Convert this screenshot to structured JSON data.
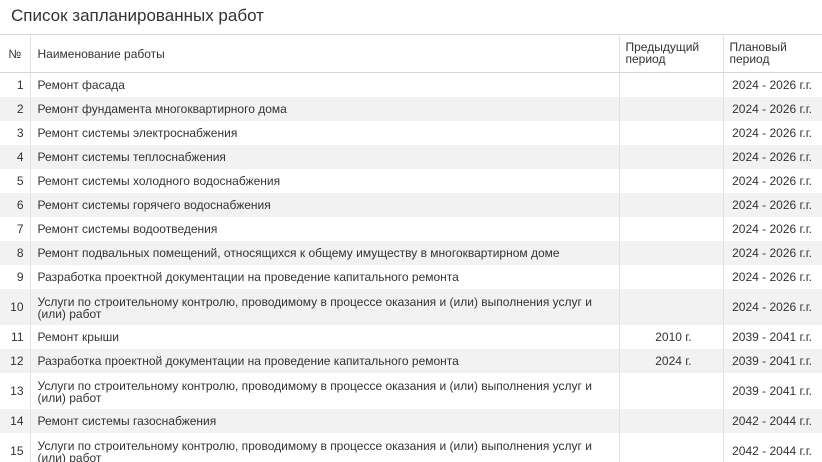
{
  "page": {
    "title": "Список запланированных работ"
  },
  "table": {
    "headers": {
      "num": "№",
      "name": "Наименование работы",
      "prev_line1": "Предыдущий",
      "prev_line2": "период",
      "plan_line1": "Плановый",
      "plan_line2": "период"
    },
    "rows": [
      {
        "num": "1",
        "name": "Ремонт фасада",
        "prev": "",
        "plan": "2024 - 2026 г.г."
      },
      {
        "num": "2",
        "name": "Ремонт фундамента многоквартирного дома",
        "prev": "",
        "plan": "2024 - 2026 г.г."
      },
      {
        "num": "3",
        "name": "Ремонт системы электроснабжения",
        "prev": "",
        "plan": "2024 - 2026 г.г."
      },
      {
        "num": "4",
        "name": "Ремонт системы теплоснабжения",
        "prev": "",
        "plan": "2024 - 2026 г.г."
      },
      {
        "num": "5",
        "name": "Ремонт системы холодного водоснабжения",
        "prev": "",
        "plan": "2024 - 2026 г.г."
      },
      {
        "num": "6",
        "name": "Ремонт системы горячего водоснабжения",
        "prev": "",
        "plan": "2024 - 2026 г.г."
      },
      {
        "num": "7",
        "name": "Ремонт системы водоотведения",
        "prev": "",
        "plan": "2024 - 2026 г.г."
      },
      {
        "num": "8",
        "name": "Ремонт подвальных помещений, относящихся к общему имуществу в многоквартирном доме",
        "prev": "",
        "plan": "2024 - 2026 г.г."
      },
      {
        "num": "9",
        "name": "Разработка проектной документации на проведение капитального ремонта",
        "prev": "",
        "plan": "2024 - 2026 г.г."
      },
      {
        "num": "10",
        "name": "Услуги по строительному контролю, проводимому в процессе оказания и (или) выполнения услуг и (или) работ",
        "prev": "",
        "plan": "2024 - 2026 г.г."
      },
      {
        "num": "11",
        "name": "Ремонт крыши",
        "prev": "2010 г.",
        "plan": "2039 - 2041 г.г."
      },
      {
        "num": "12",
        "name": "Разработка проектной документации на проведение капитального ремонта",
        "prev": "2024 г.",
        "plan": "2039 - 2041 г.г."
      },
      {
        "num": "13",
        "name": "Услуги по строительному контролю, проводимому в процессе оказания и (или) выполнения услуг и (или) работ",
        "prev": "",
        "plan": "2039 - 2041 г.г."
      },
      {
        "num": "14",
        "name": "Ремонт системы газоснабжения",
        "prev": "",
        "plan": "2042 - 2044 г.г."
      },
      {
        "num": "15",
        "name": "Услуги по строительному контролю, проводимому в процессе оказания и (или) выполнения услуг и (или) работ",
        "prev": "",
        "plan": "2042 - 2044 г.г."
      }
    ]
  }
}
